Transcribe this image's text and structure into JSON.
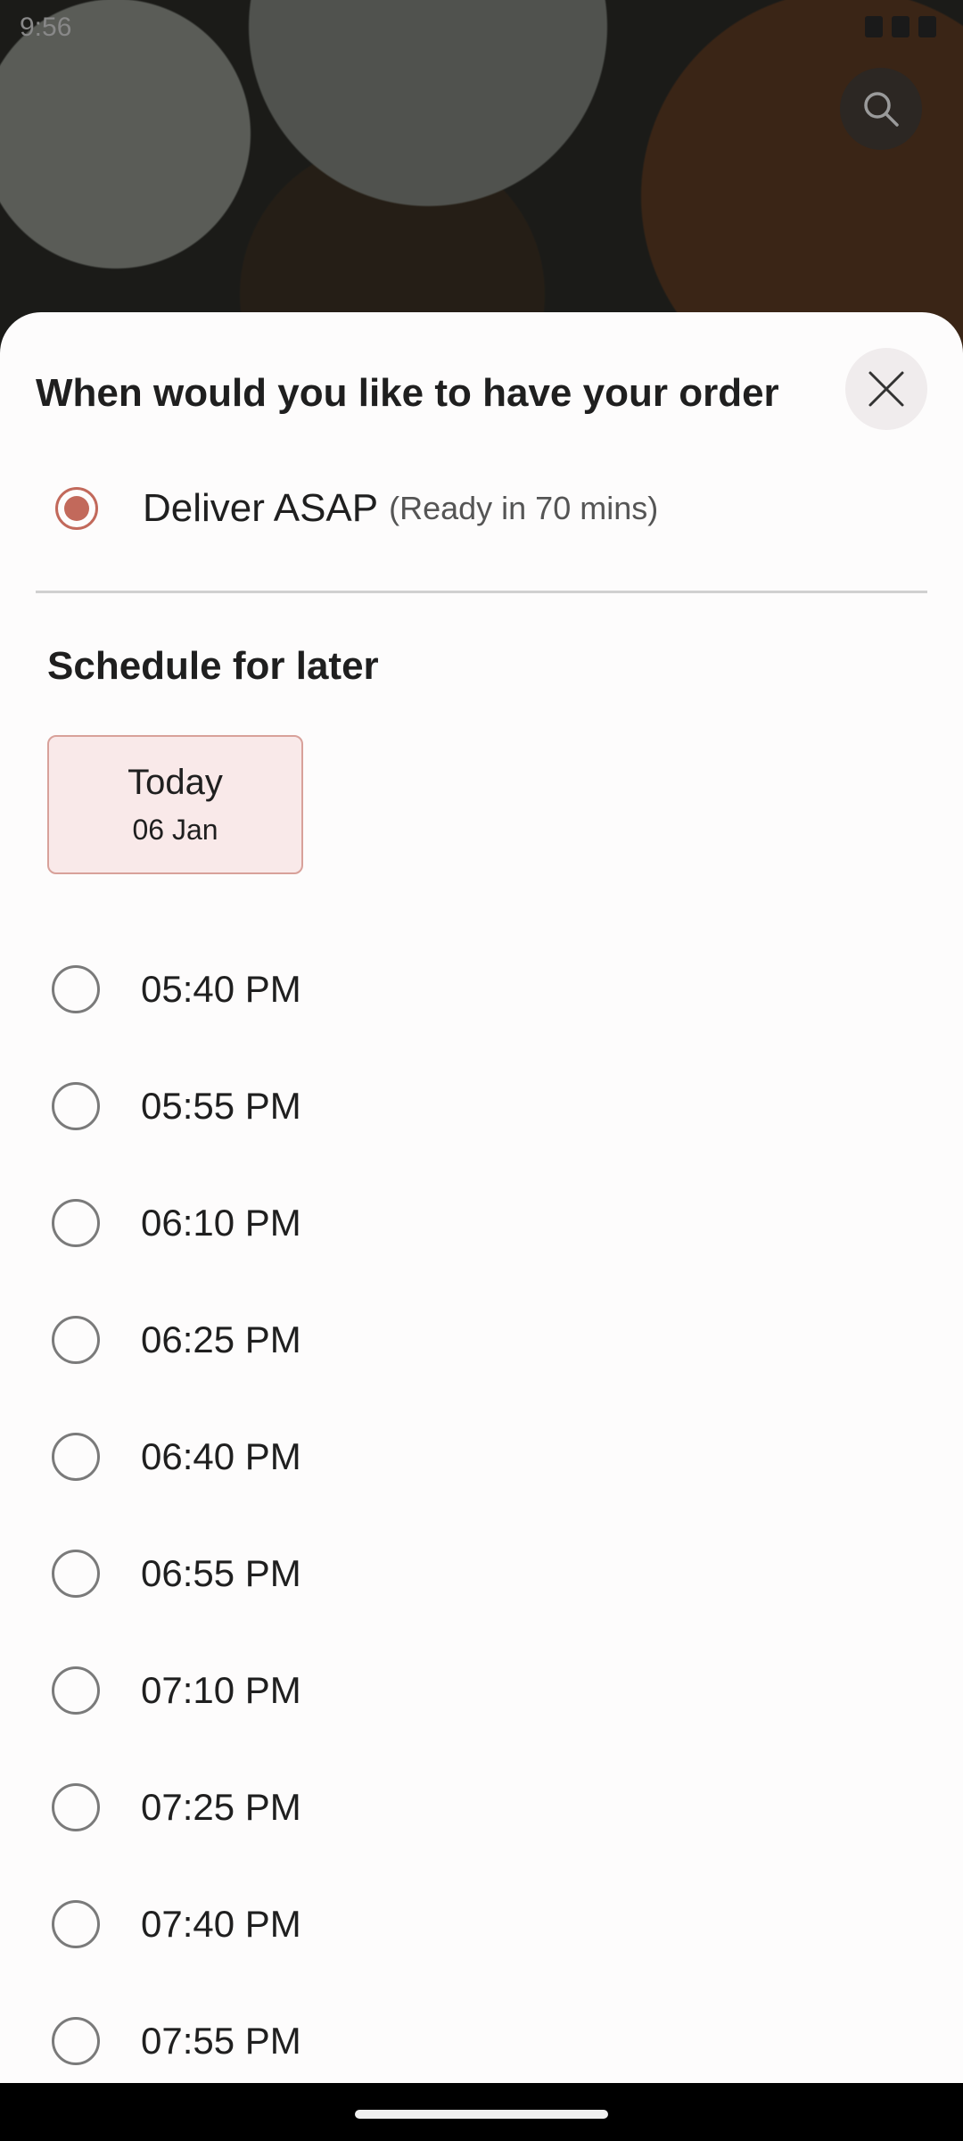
{
  "status_bar": {
    "time": "9:56"
  },
  "sheet": {
    "title": "When would you like to have your order",
    "asap": {
      "label": "Deliver ASAP",
      "sub": "(Ready in 70 mins)",
      "selected": true
    },
    "schedule_title": "Schedule for later",
    "day_chip": {
      "day": "Today",
      "date": "06 Jan"
    },
    "time_slots": [
      "05:40 PM",
      "05:55 PM",
      "06:10 PM",
      "06:25 PM",
      "06:40 PM",
      "06:55 PM",
      "07:10 PM",
      "07:25 PM",
      "07:40 PM",
      "07:55 PM"
    ]
  },
  "colors": {
    "accent": "#c2695b",
    "chip_bg": "#f9e9e9",
    "chip_border": "#d8a19a"
  }
}
